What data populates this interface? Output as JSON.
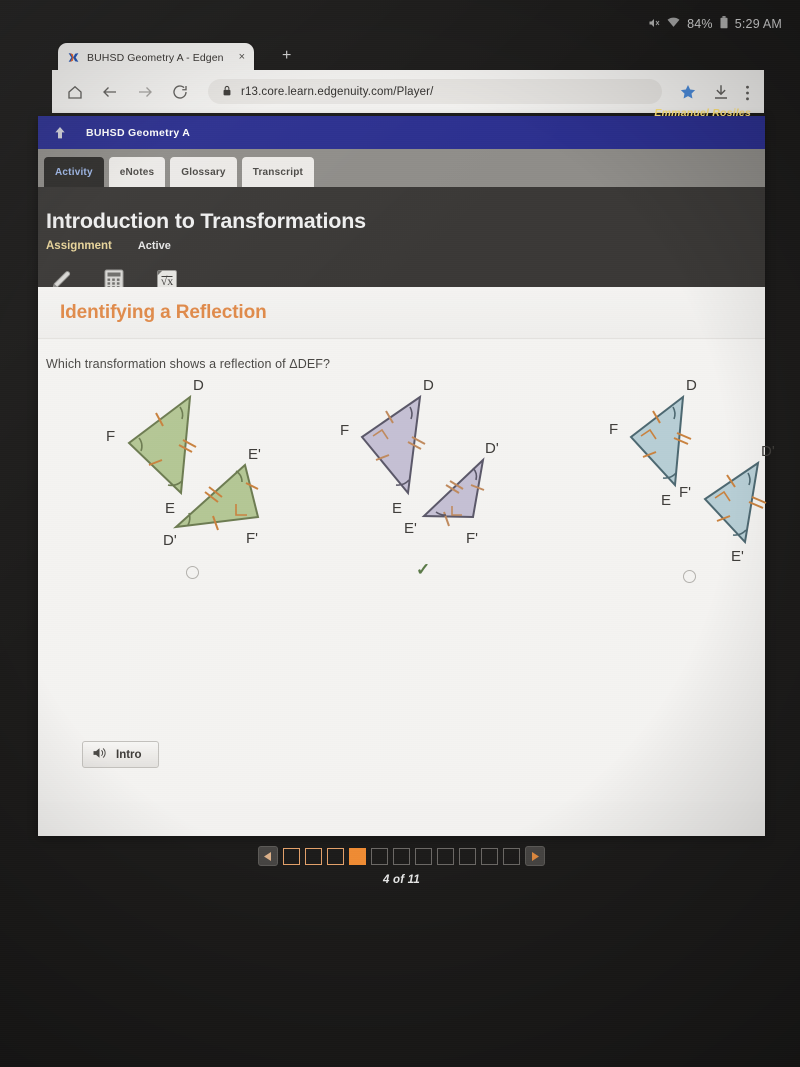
{
  "status_bar": {
    "mute_icon": "mute-icon",
    "wifi_icon": "wifi-icon",
    "battery_percent": "84%",
    "battery_icon": "battery-icon",
    "time": "5:29 AM"
  },
  "browser": {
    "favicon": "edgenuity-x-favicon",
    "tab_title": "BUHSD Geometry A - Edgen",
    "tab_close_label": "×",
    "new_tab_label": "+",
    "icons": {
      "home": "home-icon",
      "back": "back-arrow-icon",
      "forward": "forward-arrow-icon",
      "reload": "reload-icon",
      "lock": "lock-icon",
      "bookmark": "star-icon",
      "download": "download-icon",
      "menu": "overflow-menu-icon"
    },
    "url": "r13.core.learn.edgenuity.com/Player/"
  },
  "app": {
    "home_icon": "home-arrow-icon",
    "course_name": "BUHSD Geometry A",
    "user_name": "Emmanuel Rosiles",
    "tabs": [
      {
        "label": "Activity",
        "active": true
      },
      {
        "label": "eNotes",
        "active": false
      },
      {
        "label": "Glossary",
        "active": false
      },
      {
        "label": "Transcript",
        "active": false
      }
    ],
    "lesson": {
      "title": "Introduction to Transformations",
      "type": "Assignment",
      "state": "Active"
    },
    "tools": [
      {
        "name": "highlighter-tool-icon"
      },
      {
        "name": "calculator-tool-icon"
      },
      {
        "name": "formula-tool-icon",
        "label": "√x"
      }
    ],
    "content": {
      "heading": "Identifying a Reflection",
      "question": "Which transformation shows a reflection of ΔDEF?",
      "choices": [
        {
          "id": "choice-a",
          "fill": "#b4c795",
          "stroke": "#6d7c52",
          "tick": "#c9823f",
          "selected": false,
          "marker": "radio",
          "labels": [
            "D",
            "F",
            "E",
            "E'",
            "D'",
            "F'"
          ]
        },
        {
          "id": "choice-b",
          "fill": "#c5c0d4",
          "stroke": "#5b5869",
          "tick": "#c08a5e",
          "selected": true,
          "marker": "check",
          "labels": [
            "D",
            "F",
            "E",
            "D'",
            "E'",
            "F'"
          ]
        },
        {
          "id": "choice-c",
          "fill": "#b7ced5",
          "stroke": "#4d6871",
          "tick": "#c9823f",
          "selected": false,
          "marker": "radio",
          "labels": [
            "D",
            "F",
            "E",
            "D'",
            "F'",
            "E'"
          ]
        }
      ],
      "intro_button": {
        "label": "Intro",
        "icon": "speaker-icon"
      }
    },
    "pager": {
      "prev_icon": "prev-arrow-icon",
      "next_icon": "next-arrow-icon",
      "total": 11,
      "current": 4,
      "completed": 3,
      "label": "4 of 11"
    }
  }
}
